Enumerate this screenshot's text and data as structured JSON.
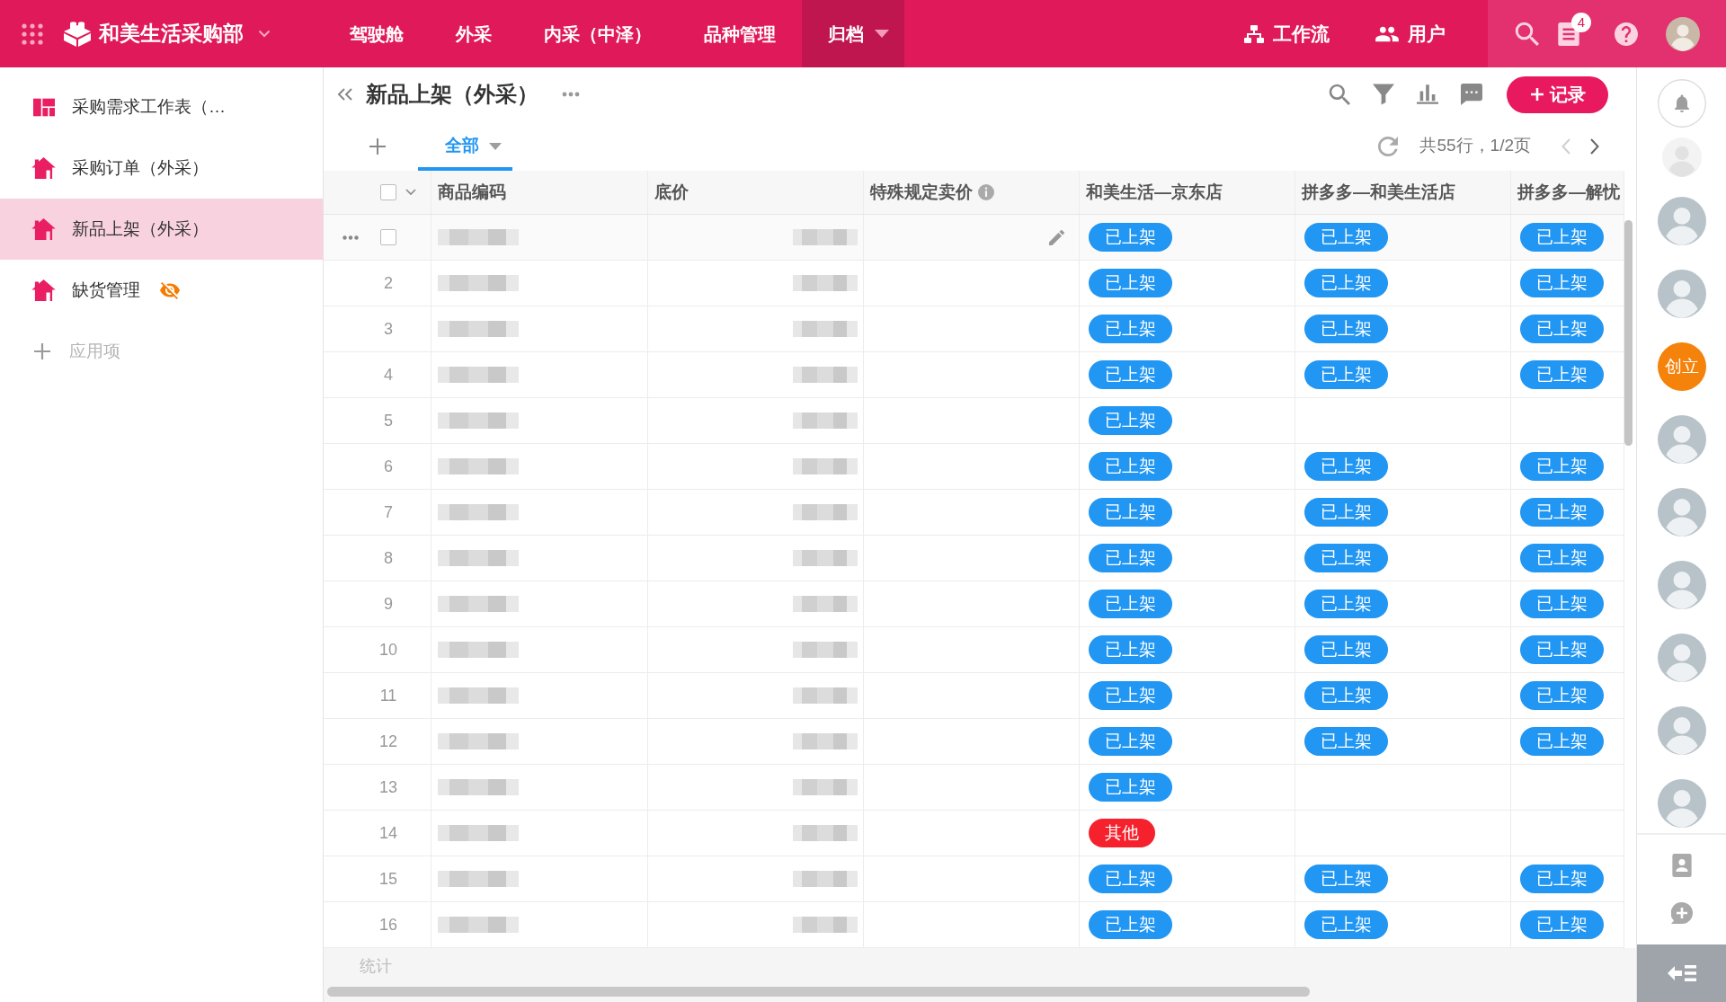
{
  "app_bar": {
    "title": "和美生活采购部",
    "nav": [
      {
        "label": "驾驶舱",
        "selected": false,
        "dropdown": false
      },
      {
        "label": "外采",
        "selected": false,
        "dropdown": false
      },
      {
        "label": "内采（中泽）",
        "selected": false,
        "dropdown": false
      },
      {
        "label": "品种管理",
        "selected": false,
        "dropdown": false
      },
      {
        "label": "归档",
        "selected": true,
        "dropdown": true
      }
    ],
    "actions": [
      {
        "kind": "workflow",
        "label": "工作流"
      },
      {
        "kind": "users",
        "label": "用户"
      }
    ],
    "tool_badge": "4"
  },
  "sidebar": {
    "items": [
      {
        "kind": "sheet",
        "label": "采购需求工作表（…",
        "selected": false,
        "hidden": false
      },
      {
        "kind": "page",
        "label": "采购订单（外采）",
        "selected": false,
        "hidden": false
      },
      {
        "kind": "page",
        "label": "新品上架（外采）",
        "selected": true,
        "hidden": false
      },
      {
        "kind": "page",
        "label": "缺货管理",
        "selected": false,
        "hidden": true
      }
    ],
    "add_label": "应用项"
  },
  "view": {
    "title": "新品上架（外采）",
    "add_button": "记录",
    "tabs": [
      {
        "label": "全部",
        "selected": true
      }
    ],
    "pager": {
      "text": "共55行，1/2页",
      "prev_disabled": true,
      "next_disabled": false
    }
  },
  "table": {
    "select_all_checked": false,
    "columns": [
      {
        "label": "商品编码",
        "kind": "text",
        "blurred": true,
        "info": false
      },
      {
        "label": "底价",
        "kind": "number",
        "blurred": true,
        "info": false
      },
      {
        "label": "特殊规定卖价",
        "kind": "number",
        "blurred": false,
        "info": true
      },
      {
        "label": "和美生活—京东店",
        "kind": "status",
        "blurred": false,
        "info": false
      },
      {
        "label": "拼多多—和美生活店",
        "kind": "status",
        "blurred": false,
        "info": false
      },
      {
        "label": "拼多多—解忧",
        "kind": "status",
        "blurred": false,
        "info": false
      }
    ],
    "rows": [
      {
        "hovered": true,
        "checked": false,
        "status": [
          {
            "label": "已上架",
            "color": "#2196f3"
          },
          {
            "label": "已上架",
            "color": "#2196f3"
          },
          {
            "label": "已上架",
            "color": "#2196f3"
          }
        ]
      },
      {
        "number": "2",
        "hovered": false,
        "checked": false,
        "status": [
          {
            "label": "已上架",
            "color": "#2196f3"
          },
          {
            "label": "已上架",
            "color": "#2196f3"
          },
          {
            "label": "已上架",
            "color": "#2196f3"
          }
        ]
      },
      {
        "number": "3",
        "hovered": false,
        "checked": false,
        "status": [
          {
            "label": "已上架",
            "color": "#2196f3"
          },
          {
            "label": "已上架",
            "color": "#2196f3"
          },
          {
            "label": "已上架",
            "color": "#2196f3"
          }
        ]
      },
      {
        "number": "4",
        "hovered": false,
        "checked": false,
        "status": [
          {
            "label": "已上架",
            "color": "#2196f3"
          },
          {
            "label": "已上架",
            "color": "#2196f3"
          },
          {
            "label": "已上架",
            "color": "#2196f3"
          }
        ]
      },
      {
        "number": "5",
        "hovered": false,
        "checked": false,
        "status": [
          {
            "label": "已上架",
            "color": "#2196f3"
          }
        ]
      },
      {
        "number": "6",
        "hovered": false,
        "checked": false,
        "status": [
          {
            "label": "已上架",
            "color": "#2196f3"
          },
          {
            "label": "已上架",
            "color": "#2196f3"
          },
          {
            "label": "已上架",
            "color": "#2196f3"
          }
        ]
      },
      {
        "number": "7",
        "hovered": false,
        "checked": false,
        "status": [
          {
            "label": "已上架",
            "color": "#2196f3"
          },
          {
            "label": "已上架",
            "color": "#2196f3"
          },
          {
            "label": "已上架",
            "color": "#2196f3"
          }
        ]
      },
      {
        "number": "8",
        "hovered": false,
        "checked": false,
        "status": [
          {
            "label": "已上架",
            "color": "#2196f3"
          },
          {
            "label": "已上架",
            "color": "#2196f3"
          },
          {
            "label": "已上架",
            "color": "#2196f3"
          }
        ]
      },
      {
        "number": "9",
        "hovered": false,
        "checked": false,
        "status": [
          {
            "label": "已上架",
            "color": "#2196f3"
          },
          {
            "label": "已上架",
            "color": "#2196f3"
          },
          {
            "label": "已上架",
            "color": "#2196f3"
          }
        ]
      },
      {
        "number": "10",
        "hovered": false,
        "checked": false,
        "status": [
          {
            "label": "已上架",
            "color": "#2196f3"
          },
          {
            "label": "已上架",
            "color": "#2196f3"
          },
          {
            "label": "已上架",
            "color": "#2196f3"
          }
        ]
      },
      {
        "number": "11",
        "hovered": false,
        "checked": false,
        "status": [
          {
            "label": "已上架",
            "color": "#2196f3"
          },
          {
            "label": "已上架",
            "color": "#2196f3"
          },
          {
            "label": "已上架",
            "color": "#2196f3"
          }
        ]
      },
      {
        "number": "12",
        "hovered": false,
        "checked": false,
        "status": [
          {
            "label": "已上架",
            "color": "#2196f3"
          },
          {
            "label": "已上架",
            "color": "#2196f3"
          },
          {
            "label": "已上架",
            "color": "#2196f3"
          }
        ]
      },
      {
        "number": "13",
        "hovered": false,
        "checked": false,
        "status": [
          {
            "label": "已上架",
            "color": "#2196f3"
          }
        ]
      },
      {
        "number": "14",
        "hovered": false,
        "checked": false,
        "status": [
          {
            "label": "其他",
            "color": "#f5222d"
          }
        ]
      },
      {
        "number": "15",
        "hovered": false,
        "checked": false,
        "status": [
          {
            "label": "已上架",
            "color": "#2196f3"
          },
          {
            "label": "已上架",
            "color": "#2196f3"
          },
          {
            "label": "已上架",
            "color": "#2196f3"
          }
        ]
      },
      {
        "number": "16",
        "hovered": false,
        "checked": false,
        "status": [
          {
            "label": "已上架",
            "color": "#2196f3"
          },
          {
            "label": "已上架",
            "color": "#2196f3"
          },
          {
            "label": "已上架",
            "color": "#2196f3"
          }
        ]
      }
    ],
    "footer": "统计"
  },
  "members": [
    {
      "kind": "faded"
    },
    {
      "kind": "photo"
    },
    {
      "kind": "photo"
    },
    {
      "kind": "text",
      "label": "创立",
      "color": "#f5820a"
    },
    {
      "kind": "photo"
    },
    {
      "kind": "photo"
    },
    {
      "kind": "photo"
    },
    {
      "kind": "photo"
    },
    {
      "kind": "photo"
    },
    {
      "kind": "photo"
    }
  ]
}
